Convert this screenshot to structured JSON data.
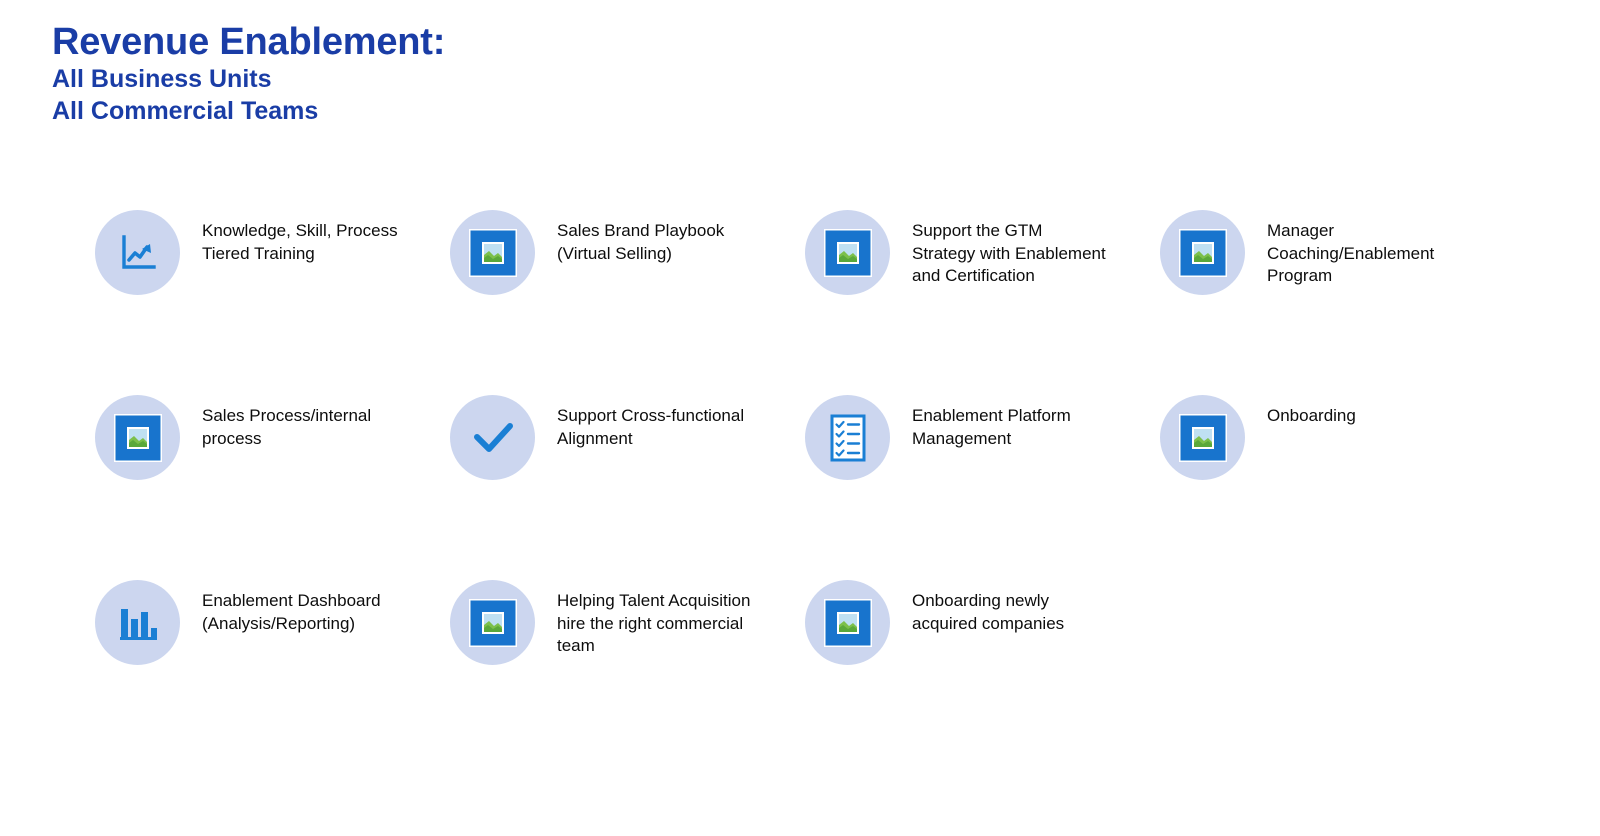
{
  "title": {
    "main": "Revenue Enablement:",
    "line2": "All Business Units",
    "line3": "All Commercial Teams"
  },
  "colors": {
    "title_blue": "#1a3da6",
    "bubble_bg": "#ccd6ef",
    "icon_blue": "#1a7fd4",
    "image_placeholder_blue": "#1874cd",
    "body_text": "#0d0d0d"
  },
  "rows": [
    {
      "items": [
        {
          "icon": "line-chart-up-icon",
          "label": "Knowledge, Skill, Process\nTiered Training"
        },
        {
          "icon": "broken-image-placeholder-icon",
          "label": "Sales Brand Playbook\n(Virtual Selling)"
        },
        {
          "icon": "broken-image-placeholder-icon",
          "label": "Support the GTM\nStrategy with Enablement\nand Certification"
        },
        {
          "icon": "broken-image-placeholder-icon",
          "label": "Manager\nCoaching/Enablement\nProgram"
        }
      ]
    },
    {
      "items": [
        {
          "icon": "broken-image-placeholder-icon",
          "label": "Sales Process/internal\nprocess"
        },
        {
          "icon": "checkmark-icon",
          "label": "Support Cross-functional\nAlignment"
        },
        {
          "icon": "checklist-clipboard-icon",
          "label": "Enablement Platform\nManagement"
        },
        {
          "icon": "broken-image-placeholder-icon",
          "label": "Onboarding"
        }
      ]
    },
    {
      "items": [
        {
          "icon": "bar-chart-icon",
          "label": "Enablement Dashboard\n(Analysis/Reporting)"
        },
        {
          "icon": "broken-image-placeholder-icon",
          "label": "Helping Talent Acquisition\nhire the right commercial\nteam"
        },
        {
          "icon": "broken-image-placeholder-icon",
          "label": "Onboarding newly\nacquired companies"
        },
        {
          "icon": "none",
          "label": ""
        }
      ]
    }
  ]
}
